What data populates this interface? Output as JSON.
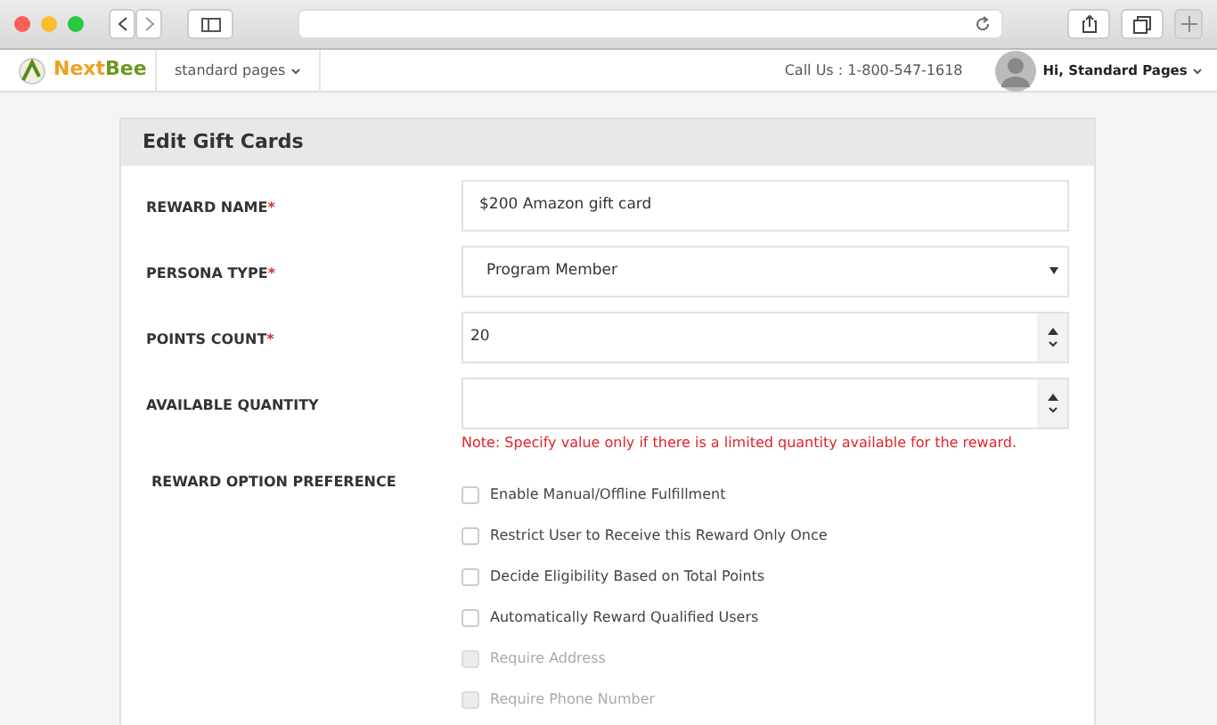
{
  "nav": {
    "menu": "standard pages",
    "phone": "Call Us : 1-800-547-1618",
    "user": "Hi, Standard Pages"
  },
  "logo": {
    "text_1": "Next",
    "text_2": "Bee"
  },
  "card": {
    "title": "Edit Gift Cards"
  },
  "fields": [
    {
      "kind": "text",
      "label": "REWARD NAME",
      "required_mark": "*",
      "value": "$200 Amazon gift card"
    },
    {
      "kind": "select",
      "label": "PERSONA TYPE",
      "required_mark": "*",
      "value": "Program Member"
    },
    {
      "kind": "number",
      "label": "POINTS COUNT",
      "required_mark": "*",
      "value": "20"
    },
    {
      "kind": "number",
      "label": "AVAILABLE QUANTITY",
      "note": "Note: Specify value only if there is a limited quantity available for the reward."
    }
  ],
  "preference": {
    "label": "REWARD OPTION PREFERENCE",
    "options": [
      {
        "label": "Enable Manual/Offline Fulfillment",
        "checked": false,
        "disabled": false
      },
      {
        "label": "Restrict User to Receive this Reward Only Once",
        "checked": false,
        "disabled": false
      },
      {
        "label": "Decide Eligibility Based on Total Points",
        "checked": false,
        "disabled": false
      },
      {
        "label": "Automatically Reward Qualified Users",
        "checked": false,
        "disabled": false
      },
      {
        "label": "Require Address",
        "checked": false,
        "disabled": true
      },
      {
        "label": "Require Phone Number",
        "checked": false,
        "disabled": true
      }
    ]
  }
}
